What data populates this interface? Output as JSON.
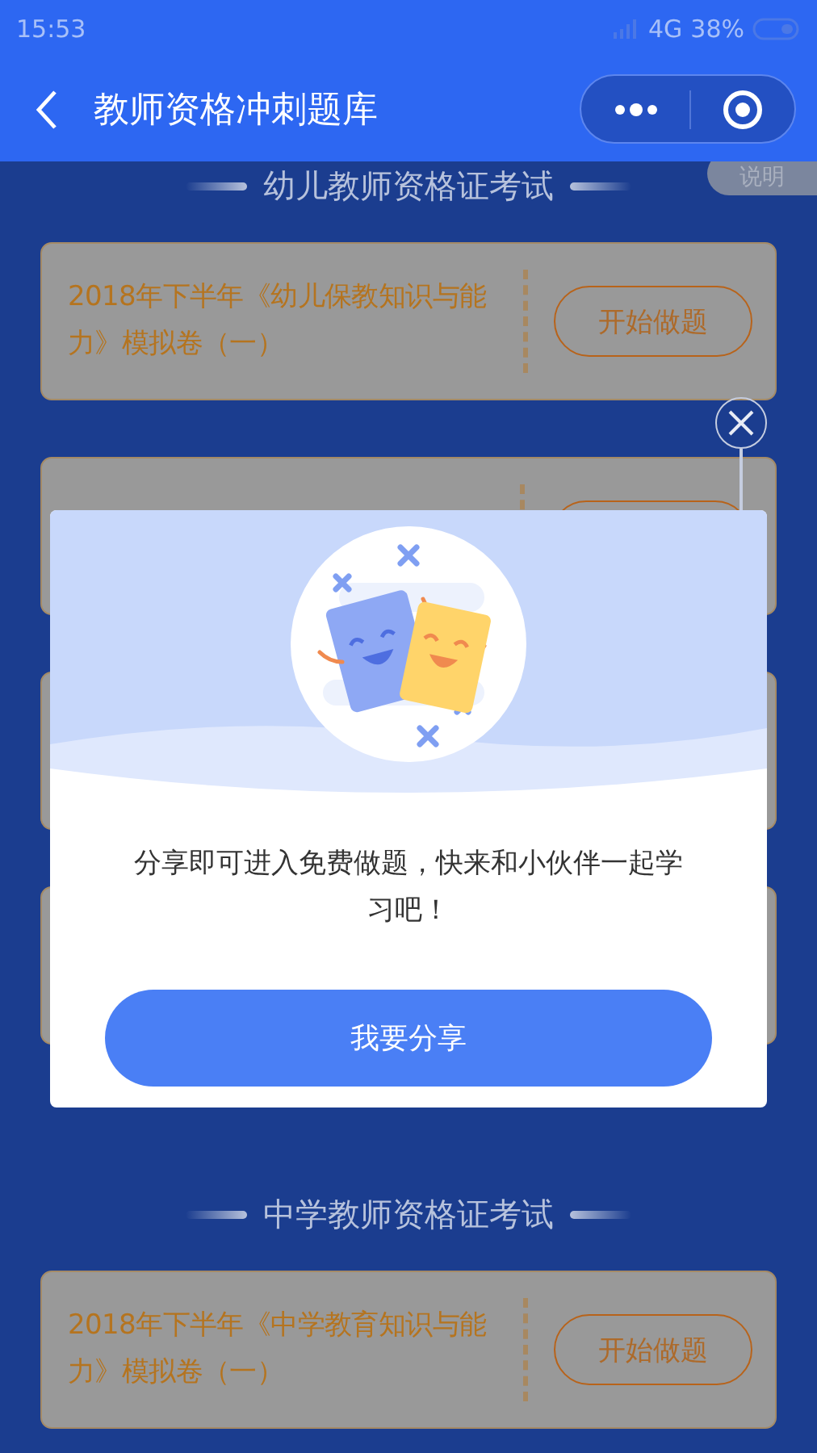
{
  "status_bar": {
    "time": "15:53",
    "network": "4G",
    "battery": "38%"
  },
  "nav": {
    "title": "教师资格冲刺题库"
  },
  "help_tab": "说明",
  "sections": [
    {
      "title": "幼儿教师资格证考试",
      "cards": [
        {
          "kind": "visible",
          "title": "2018年下半年《幼儿保教知识与能力》模拟卷（一）",
          "button": "开始做题"
        },
        {
          "kind": "covered"
        },
        {
          "kind": "covered"
        },
        {
          "kind": "covered"
        }
      ]
    },
    {
      "title": "中学教师资格证考试",
      "cards": [
        {
          "kind": "visible",
          "title": "2018年下半年《中学教育知识与能力》模拟卷（一）",
          "button": "开始做题"
        }
      ]
    }
  ],
  "share_dialog": {
    "message": "分享即可进入免费做题，快来和小伙伴一起学习吧！",
    "button": "我要分享"
  }
}
